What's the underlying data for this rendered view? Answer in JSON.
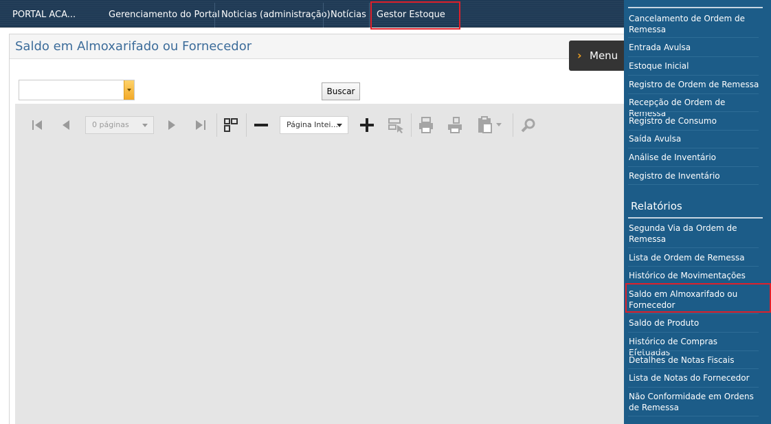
{
  "topbar": {
    "brand": "PORTAL ACA...",
    "nav": [
      "Gerenciamento do Portal",
      "Noticias (administração)",
      "Notícias",
      "Gestor Estoque"
    ]
  },
  "page": {
    "title": "Saldo em Almoxarifado ou Fornecedor",
    "search_button": "Buscar",
    "menu_label": "Menu"
  },
  "viewer_toolbar": {
    "pages_select": "0 páginas",
    "zoom_select": "Página Intei..."
  },
  "sidebar": {
    "section_top_items": [
      "Cancelamento de Ordem de Remessa",
      "Entrada Avulsa",
      "Estoque Inicial",
      "Registro de Ordem de Remessa",
      "Recepção de Ordem de Remessa",
      "Registro de Consumo",
      "Saída Avulsa",
      "Análise de Inventário",
      "Registro de Inventário"
    ],
    "reports_heading": "Relatórios",
    "reports_items": [
      "Segunda Via da Ordem de Remessa",
      "Lista de Ordem de Remessa",
      "Histórico de Movimentações",
      "Saldo em Almoxarifado ou Fornecedor",
      "Saldo de Produto",
      "Histórico de Compras Efetuadas",
      "Detalhes de Notas Fiscais",
      "Lista de Notas do Fornecedor",
      "Não Conformidade em Ordens de Remessa"
    ]
  },
  "colors": {
    "topbar": "#1f3a55",
    "sidebar": "#1c5c88",
    "highlight": "#e0202a",
    "title": "#3c6c9a"
  }
}
